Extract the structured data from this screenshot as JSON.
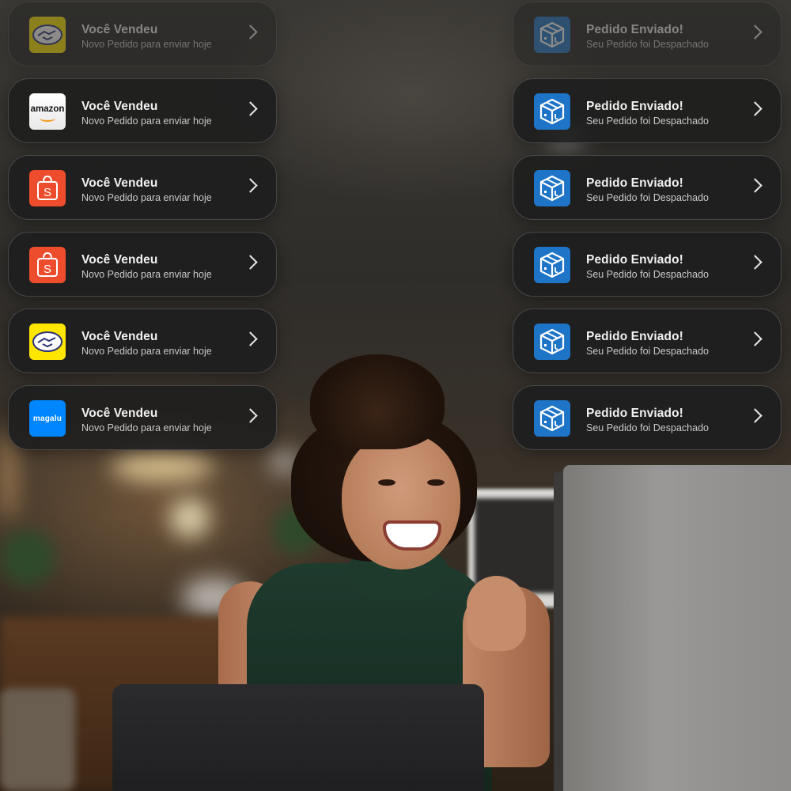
{
  "notifications": {
    "left": [
      {
        "app": "mercado-livre",
        "icon": "handshake-icon",
        "title": "Você Vendeu",
        "subtitle": "Novo Pedido para enviar hoje",
        "faded": true
      },
      {
        "app": "amazon",
        "icon": "amazon-logo-icon",
        "icon_text": "amazon",
        "title": "Você Vendeu",
        "subtitle": "Novo Pedido para enviar hoje"
      },
      {
        "app": "shopee",
        "icon": "shopping-bag-icon",
        "icon_text": "S",
        "title": "Você Vendeu",
        "subtitle": "Novo Pedido para enviar hoje"
      },
      {
        "app": "shopee",
        "icon": "shopping-bag-icon",
        "icon_text": "S",
        "title": "Você Vendeu",
        "subtitle": "Novo Pedido para enviar hoje"
      },
      {
        "app": "mercado-livre",
        "icon": "handshake-icon",
        "title": "Você Vendeu",
        "subtitle": "Novo Pedido para enviar hoje"
      },
      {
        "app": "magalu",
        "icon": "magalu-logo-icon",
        "icon_text": "magalu",
        "title": "Você Vendeu",
        "subtitle": "Novo Pedido para enviar hoje"
      }
    ],
    "right": [
      {
        "icon": "package-box-icon",
        "title": "Pedido Enviado!",
        "subtitle": "Seu Pedido foi Despachado",
        "faded": true
      },
      {
        "icon": "package-box-icon",
        "title": "Pedido Enviado!",
        "subtitle": "Seu Pedido foi Despachado"
      },
      {
        "icon": "package-box-icon",
        "title": "Pedido Enviado!",
        "subtitle": "Seu Pedido foi Despachado"
      },
      {
        "icon": "package-box-icon",
        "title": "Pedido Enviado!",
        "subtitle": "Seu Pedido foi Despachado"
      },
      {
        "icon": "package-box-icon",
        "title": "Pedido Enviado!",
        "subtitle": "Seu Pedido foi Despachado"
      },
      {
        "icon": "package-box-icon",
        "title": "Pedido Enviado!",
        "subtitle": "Seu Pedido foi Despachado"
      }
    ]
  },
  "colors": {
    "card_bg": "#1e1e1e",
    "amazon_orange": "#f39a1e",
    "shopee_orange": "#ee4d2d",
    "meli_yellow": "#ffe600",
    "magalu_blue": "#0086ff",
    "box_blue": "#1e74c6"
  }
}
